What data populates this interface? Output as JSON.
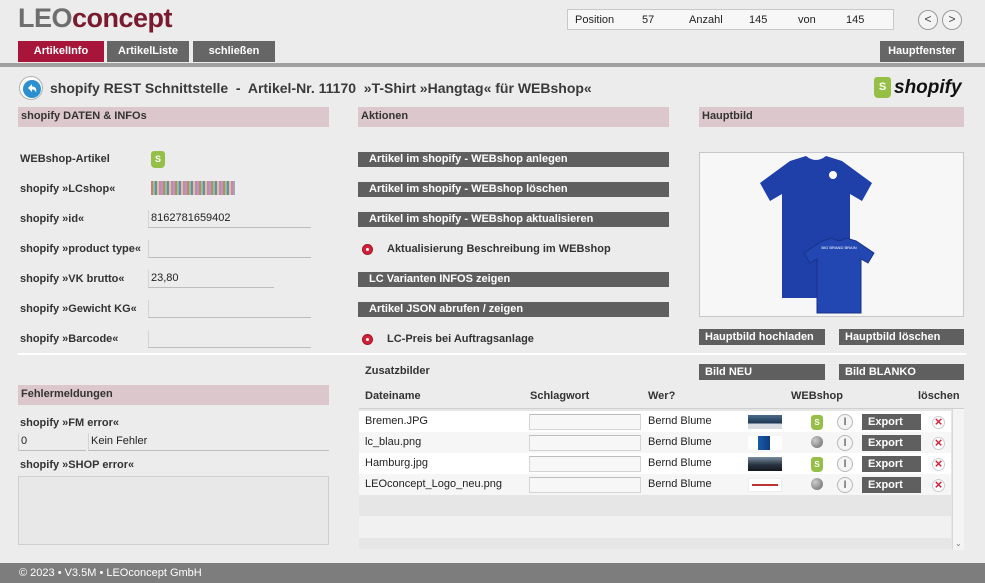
{
  "app": {
    "logo_prefix": "LEO",
    "logo_suffix": "concept"
  },
  "nav": {
    "position_label": "Position",
    "position_value": "57",
    "count_label": "Anzahl",
    "count_value": "145",
    "of_label": "von",
    "of_value": "145",
    "prev": "<",
    "next": ">"
  },
  "tabs": {
    "artikelinfo": "ArtikelInfo",
    "artikelliste": "ArtikelListe",
    "schliessen": "schließen",
    "hauptfenster": "Hauptfenster"
  },
  "header": {
    "title": "shopify REST Schnittstelle  -  Artikel-Nr. 11170  »T-Shirt »Hangtag« für WEBshop«",
    "brand": "shopify"
  },
  "left": {
    "section_title": "shopify DATEN & INFOs",
    "fields": {
      "webshop_label": "WEBshop-Artikel",
      "lcshop_label": "shopify »LCshop«",
      "id_label": "shopify »id«",
      "id_value": "8162781659402",
      "product_type_label": "shopify »product type«",
      "product_type_value": "",
      "vk_label": "shopify »VK brutto«",
      "vk_value": "23,80",
      "gewicht_label": "shopify »Gewicht KG«",
      "gewicht_value": "",
      "barcode_label": "shopify »Barcode«",
      "barcode_value": ""
    },
    "errors_title": "Fehlermeldungen",
    "fm_label": "shopify »FM error«",
    "fm_code": "0",
    "fm_text": "Kein Fehler",
    "shop_label": "shopify »SHOP error«"
  },
  "actions": {
    "section_title": "Aktionen",
    "create": "Artikel im shopify - WEBshop anlegen",
    "delete": "Artikel im shopify - WEBshop löschen",
    "update": "Artikel im shopify - WEBshop aktualisieren",
    "update_desc": "Aktualisierung Beschreibung im WEBshop",
    "variants": "LC Varianten INFOS zeigen",
    "json": "Artikel JSON abrufen / zeigen",
    "lc_price": "LC-Preis bei Auftragsanlage"
  },
  "mainimage": {
    "section_title": "Hauptbild",
    "upload": "Hauptbild hochladen",
    "remove": "Hauptbild löschen",
    "shirt_print": "BIG BRAND BRAIN"
  },
  "extra": {
    "title": "Zusatzbilder",
    "btn_new": "Bild NEU",
    "btn_blank": "Bild BLANKO",
    "columns": {
      "file": "Dateiname",
      "keyword": "Schlagwort",
      "who": "Wer?",
      "webshop": "WEBshop",
      "delete": "löschen"
    },
    "export_label": "Export",
    "info_label": "I",
    "rows": [
      {
        "file": "Bremen.JPG",
        "who": "Bernd Blume",
        "in_shop": true
      },
      {
        "file": "lc_blau.png",
        "who": "Bernd Blume",
        "in_shop": false
      },
      {
        "file": "Hamburg.jpg",
        "who": "Bernd Blume",
        "in_shop": true
      },
      {
        "file": "LEOconcept_Logo_neu.png",
        "who": "Bernd Blume",
        "in_shop": false
      }
    ]
  },
  "footer": {
    "text": "© 2023 • V3.5M • LEOconcept GmbH"
  },
  "colors": {
    "accent": "#a8153a",
    "button": "#5f5f5f",
    "section_bg": "#dcc8cc",
    "shopify_green": "#95bf47"
  }
}
